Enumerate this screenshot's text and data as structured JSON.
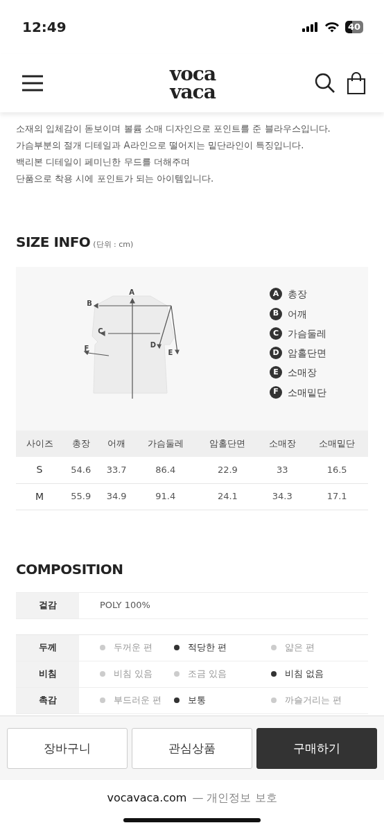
{
  "status_bar": {
    "time": "12:49",
    "battery": "40"
  },
  "header": {
    "logo_lines": [
      "voca",
      "vaca"
    ]
  },
  "description": [
    "소재의 입체감이 돋보이며 볼륨 소매 디자인으로 포인트를 준 블라우스입니다.",
    "가슴부분의 절개 디테일과 A라인으로 떨어지는 밑단라인이 특징입니다.",
    "백리본 디테일이 페미닌한 무드를 더해주며",
    "단품으로 착용 시에 포인트가 되는 아이템입니다."
  ],
  "size_info": {
    "title": "SIZE INFO",
    "unit": "(단위 : cm)",
    "diagram_labels": [
      "A",
      "B",
      "C",
      "D",
      "E",
      "F"
    ],
    "legend": [
      {
        "letter": "A",
        "label": "총장"
      },
      {
        "letter": "B",
        "label": "어깨"
      },
      {
        "letter": "C",
        "label": "가슴둘레"
      },
      {
        "letter": "D",
        "label": "암홀단면"
      },
      {
        "letter": "E",
        "label": "소매장"
      },
      {
        "letter": "F",
        "label": "소매밑단"
      }
    ],
    "columns": [
      "사이즈",
      "총장",
      "어깨",
      "가슴둘레",
      "암홀단면",
      "소매장",
      "소매밑단"
    ],
    "rows": [
      [
        "S",
        "54.6",
        "33.7",
        "86.4",
        "22.9",
        "33",
        "16.5"
      ],
      [
        "M",
        "55.9",
        "34.9",
        "91.4",
        "24.1",
        "34.3",
        "17.1"
      ]
    ]
  },
  "composition": {
    "title": "COMPOSITION",
    "fabric": {
      "label": "겉감",
      "value": "POLY 100%"
    },
    "attributes": [
      {
        "label": "두께",
        "options": [
          {
            "text": "두꺼운 편",
            "selected": false
          },
          {
            "text": "적당한 편",
            "selected": true
          },
          {
            "text": "얇은 편",
            "selected": false
          }
        ]
      },
      {
        "label": "비침",
        "options": [
          {
            "text": "비침 있음",
            "selected": false
          },
          {
            "text": "조금 있음",
            "selected": false
          },
          {
            "text": "비침 없음",
            "selected": true
          }
        ]
      },
      {
        "label": "촉감",
        "options": [
          {
            "text": "부드러운 편",
            "selected": false
          },
          {
            "text": "보통",
            "selected": true
          },
          {
            "text": "까슬거리는 편",
            "selected": false
          }
        ]
      }
    ]
  },
  "actions": [
    {
      "label": "장바구니",
      "kind": "outline"
    },
    {
      "label": "관심상품",
      "kind": "outline"
    },
    {
      "label": "구매하기",
      "kind": "primary"
    }
  ],
  "browser_bar": {
    "domain": "vocavaca.com",
    "suffix": "— 개인정보 보호"
  }
}
